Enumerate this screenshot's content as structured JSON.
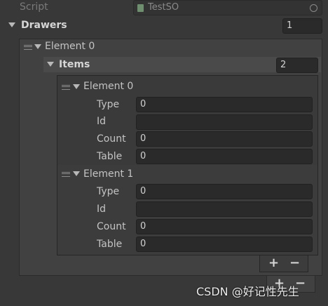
{
  "script_row": {
    "label": "Script",
    "value": "TestSO"
  },
  "drawers": {
    "label": "Drawers",
    "size": "1",
    "element0": {
      "label": "Element 0",
      "items": {
        "label": "Items",
        "size": "2",
        "elements": [
          {
            "label": "Element 0",
            "fields": [
              {
                "label": "Type",
                "value": "0"
              },
              {
                "label": "Id",
                "value": ""
              },
              {
                "label": "Count",
                "value": "0"
              },
              {
                "label": "Table",
                "value": "0"
              }
            ]
          },
          {
            "label": "Element 1",
            "fields": [
              {
                "label": "Type",
                "value": "0"
              },
              {
                "label": "Id",
                "value": ""
              },
              {
                "label": "Count",
                "value": "0"
              },
              {
                "label": "Table",
                "value": "0"
              }
            ]
          }
        ]
      }
    }
  },
  "buttons": {
    "add": "+",
    "remove": "−"
  },
  "watermark": "CSDN @好记性先生"
}
